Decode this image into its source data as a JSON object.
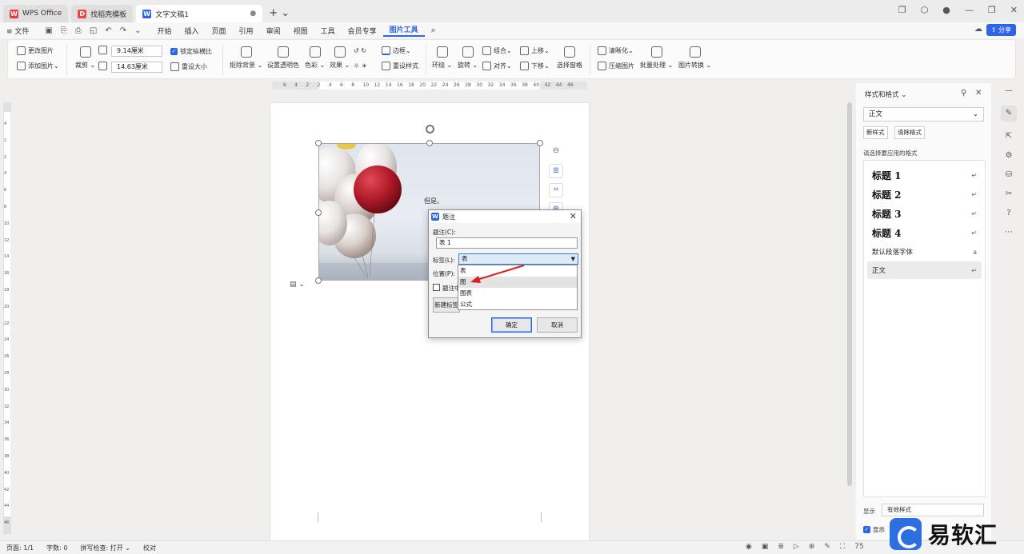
{
  "titlebar": {
    "tabs": [
      {
        "label": "WPS Office",
        "icon": "wps-icon"
      },
      {
        "label": "找稻壳模板",
        "icon": "docer-icon"
      },
      {
        "label": "文字文稿1",
        "icon": "writer-icon"
      }
    ]
  },
  "menubar": {
    "file": "文件",
    "items": [
      "开始",
      "插入",
      "页面",
      "引用",
      "审阅",
      "视图",
      "工具",
      "会员专享",
      "图片工具"
    ],
    "active": "图片工具",
    "share": "分享"
  },
  "ribbon": {
    "change_picture": "更改图片",
    "add_picture": "添加图片",
    "crop": "裁剪",
    "height": "9.14厘米",
    "width": "14.63厘米",
    "lock_ratio": "锁定纵横比",
    "reset_size": "重设大小",
    "remove_bg": "抠除背景",
    "set_transparent": "设置透明色",
    "color": "色彩",
    "effects": "效果",
    "border": "边框",
    "reset_style": "重设样式",
    "wrap": "环绕",
    "rotate": "旋转",
    "group": "组合",
    "align": "对齐",
    "bring_forward": "上移",
    "send_backward": "下移",
    "selection_pane": "选择窗格",
    "sharpen": "清晰化",
    "compress": "压缩图片",
    "batch": "批量处理",
    "convert": "图片转换"
  },
  "hruler": [
    "6",
    "4",
    "2",
    "2",
    "4",
    "6",
    "8",
    "10",
    "12",
    "14",
    "16",
    "18",
    "20",
    "22",
    "24",
    "26",
    "28",
    "30",
    "32",
    "34",
    "36",
    "38",
    "40",
    "42",
    "44",
    "46"
  ],
  "vruler": [
    "4",
    "2",
    "2",
    "4",
    "6",
    "8",
    "10",
    "12",
    "14",
    "16",
    "18",
    "20",
    "22",
    "24",
    "26",
    "28",
    "30",
    "32",
    "34",
    "36",
    "38",
    "40",
    "42",
    "44",
    "46"
  ],
  "document": {
    "text": "但是。"
  },
  "dialog": {
    "title": "题注",
    "caption_label": "题注(C):",
    "caption_value": "表 1",
    "label_label": "标签(L):",
    "label_value": "表",
    "position_label": "位置(P):",
    "exclude_label": "题注中",
    "new_label": "新建标签",
    "options": [
      "表",
      "图",
      "图表",
      "公式"
    ],
    "highlighted": "图",
    "ok": "确定",
    "cancel": "取消"
  },
  "pane": {
    "title": "样式和格式",
    "current_style": "正文",
    "new_style": "新样式",
    "clear_format": "清除格式",
    "hint": "请选择要应用的格式",
    "styles": [
      "标题 1",
      "标题 2",
      "标题 3",
      "标题 4",
      "默认段落字体",
      "正文"
    ],
    "show_label": "显示",
    "show_value": "有效样式",
    "show_preview": "显示"
  },
  "statusbar": {
    "page": "页面: 1/1",
    "words": "字数: 0",
    "spell": "拼写检查: 打开",
    "proof": "校对",
    "zoom": "75"
  },
  "watermark": {
    "text": "易软汇"
  },
  "colors": {
    "accent": "#2d64e8",
    "balloon_red": "#b01a2a"
  }
}
